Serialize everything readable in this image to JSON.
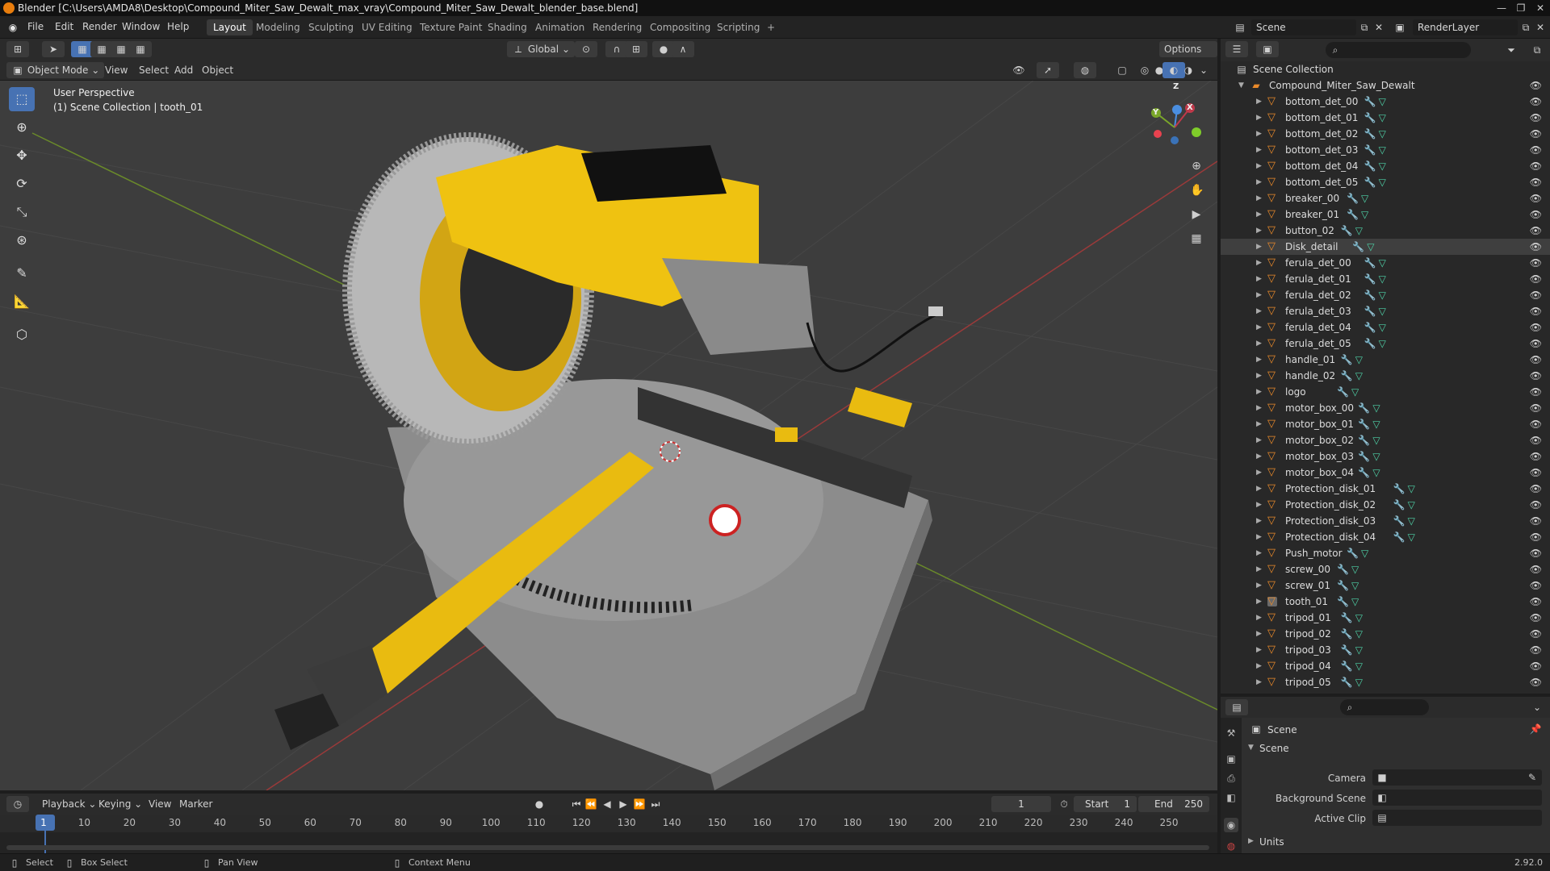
{
  "window": {
    "title": "Blender [C:\\Users\\AMDA8\\Desktop\\Compound_Miter_Saw_Dewalt_max_vray\\Compound_Miter_Saw_Dewalt_blender_base.blend]"
  },
  "menubar": {
    "items": [
      "File",
      "Edit",
      "Render",
      "Window",
      "Help"
    ],
    "workspaces": [
      "Layout",
      "Modeling",
      "Sculpting",
      "UV Editing",
      "Texture Paint",
      "Shading",
      "Animation",
      "Rendering",
      "Compositing",
      "Scripting"
    ],
    "active_workspace": "Layout",
    "add_tab": "+",
    "scene_label": "Scene",
    "render_layer_label": "RenderLayer"
  },
  "viewport_header": {
    "transform_orientation": "Global",
    "options_label": "Options",
    "mode": "Object Mode",
    "menus": [
      "View",
      "Select",
      "Add",
      "Object"
    ]
  },
  "viewport": {
    "perspective_label": "User Perspective",
    "collection_label": "(1) Scene Collection | tooth_01",
    "gizmo_x": "X",
    "gizmo_y": "Y",
    "gizmo_z": "Z"
  },
  "outliner": {
    "root": "Scene Collection",
    "collection": "Compound_Miter_Saw_Dewalt",
    "objects": [
      "bottom_det_00",
      "bottom_det_01",
      "bottom_det_02",
      "bottom_det_03",
      "bottom_det_04",
      "bottom_det_05",
      "breaker_00",
      "breaker_01",
      "button_02",
      "Disk_detail",
      "ferula_det_00",
      "ferula_det_01",
      "ferula_det_02",
      "ferula_det_03",
      "ferula_det_04",
      "ferula_det_05",
      "handle_01",
      "handle_02",
      "logo",
      "motor_box_00",
      "motor_box_01",
      "motor_box_02",
      "motor_box_03",
      "motor_box_04",
      "Protection_disk_01",
      "Protection_disk_02",
      "Protection_disk_03",
      "Protection_disk_04",
      "Push_motor",
      "screw_00",
      "screw_01",
      "tooth_01",
      "tripod_01",
      "tripod_02",
      "tripod_03",
      "tripod_04",
      "tripod_05"
    ],
    "highlighted_object": "Disk_detail",
    "active_object": "tooth_01"
  },
  "properties": {
    "context": "Scene",
    "panel_title": "Scene",
    "fields": [
      {
        "label": "Camera"
      },
      {
        "label": "Background Scene"
      },
      {
        "label": "Active Clip"
      }
    ],
    "units_panel": "Units",
    "version": "2.92.0"
  },
  "timeline": {
    "menus": [
      "Playback",
      "Keying",
      "View",
      "Marker"
    ],
    "current_frame": "1",
    "start_label": "Start",
    "start_value": "1",
    "end_label": "End",
    "end_value": "250",
    "ruler": [
      "1",
      "10",
      "20",
      "30",
      "40",
      "50",
      "60",
      "70",
      "80",
      "90",
      "100",
      "110",
      "120",
      "130",
      "140",
      "150",
      "160",
      "170",
      "180",
      "190",
      "200",
      "210",
      "220",
      "230",
      "240",
      "250"
    ]
  },
  "statusbar": {
    "items": [
      "Select",
      "Box Select",
      "Pan View",
      "Context Menu"
    ]
  },
  "colors": {
    "accent": "#4772b3",
    "object_icon": "#ea8a2a",
    "saw_yellow": "#f2c300"
  }
}
